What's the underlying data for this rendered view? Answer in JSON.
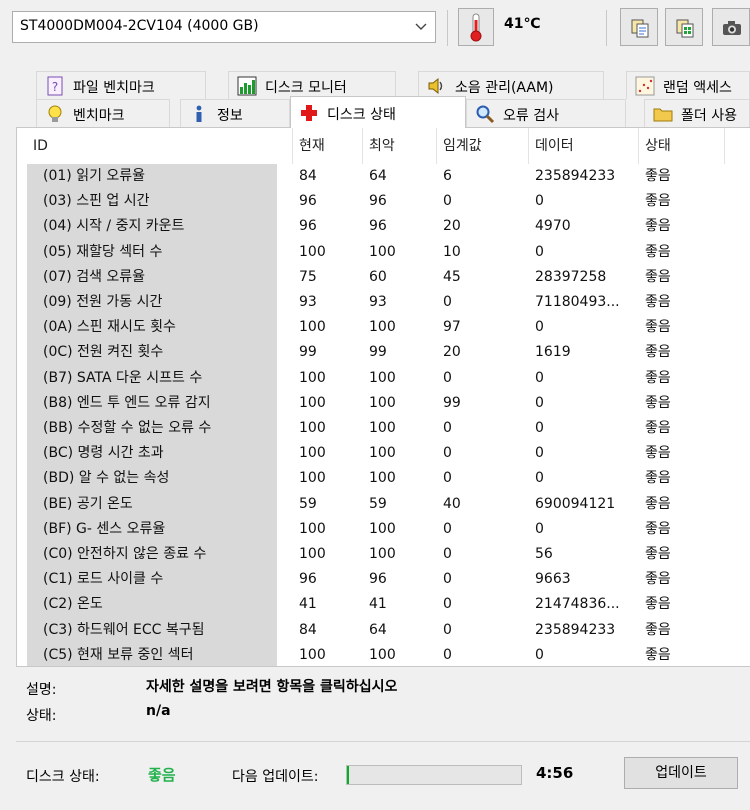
{
  "toolbar": {
    "drive": "ST4000DM004-2CV104 (4000 GB)",
    "temperature": "41℃"
  },
  "tabs": {
    "row1": [
      "파일 벤치마크",
      "디스크 모니터",
      "소음 관리(AAM)",
      "랜덤 액세스"
    ],
    "row2": [
      "벤치마크",
      "정보",
      "디스크 상태",
      "오류 검사",
      "폴더 사용"
    ],
    "active": "디스크 상태"
  },
  "table": {
    "headers": [
      "ID",
      "현재",
      "최악",
      "임계값",
      "데이터",
      "상태"
    ],
    "rows": [
      [
        "(01) 읽기 오류율",
        "84",
        "64",
        "6",
        "235894233",
        "좋음"
      ],
      [
        "(03) 스핀 업 시간",
        "96",
        "96",
        "0",
        "0",
        "좋음"
      ],
      [
        "(04) 시작 / 중지 카운트",
        "96",
        "96",
        "20",
        "4970",
        "좋음"
      ],
      [
        "(05) 재할당 섹터 수",
        "100",
        "100",
        "10",
        "0",
        "좋음"
      ],
      [
        "(07) 검색 오류율",
        "75",
        "60",
        "45",
        "28397258",
        "좋음"
      ],
      [
        "(09) 전원 가동 시간",
        "93",
        "93",
        "0",
        "71180493...",
        "좋음"
      ],
      [
        "(0A) 스핀 재시도 횟수",
        "100",
        "100",
        "97",
        "0",
        "좋음"
      ],
      [
        "(0C) 전원 켜진 횟수",
        "99",
        "99",
        "20",
        "1619",
        "좋음"
      ],
      [
        "(B7) SATA 다운 시프트 수",
        "100",
        "100",
        "0",
        "0",
        "좋음"
      ],
      [
        "(B8) 엔드 투 엔드 오류 감지",
        "100",
        "100",
        "99",
        "0",
        "좋음"
      ],
      [
        "(BB) 수정할 수 없는 오류 수",
        "100",
        "100",
        "0",
        "0",
        "좋음"
      ],
      [
        "(BC) 명령 시간 초과",
        "100",
        "100",
        "0",
        "0",
        "좋음"
      ],
      [
        "(BD) 알 수 없는 속성",
        "100",
        "100",
        "0",
        "0",
        "좋음"
      ],
      [
        "(BE) 공기 온도",
        "59",
        "59",
        "40",
        "690094121",
        "좋음"
      ],
      [
        "(BF) G- 센스 오류율",
        "100",
        "100",
        "0",
        "0",
        "좋음"
      ],
      [
        "(C0) 안전하지 않은 종료 수",
        "100",
        "100",
        "0",
        "56",
        "좋음"
      ],
      [
        "(C1) 로드 사이클 수",
        "96",
        "96",
        "0",
        "9663",
        "좋음"
      ],
      [
        "(C2) 온도",
        "41",
        "41",
        "0",
        "21474836...",
        "좋음"
      ],
      [
        "(C3) 하드웨어 ECC 복구됨",
        "84",
        "64",
        "0",
        "235894233",
        "좋음"
      ],
      [
        "(C5) 현재 보류 중인 섹터",
        "100",
        "100",
        "0",
        "0",
        "좋음"
      ]
    ]
  },
  "details": {
    "description_label": "설명:",
    "description_value": "자세한 설명을 보려면 항목을 클릭하십시오",
    "status_label": "상태:",
    "status_value": "n/a"
  },
  "footer": {
    "disk_status_label": "디스크 상태:",
    "disk_status_value": "좋음",
    "next_update_label": "다음 업데이트:",
    "progress_fraction": 0.01,
    "timer": "4:56",
    "update_button": "업데이트"
  },
  "colors": {
    "good": "#22b14c",
    "progress": "#06b025"
  },
  "icons": {
    "toolbar": [
      "thermometer-icon",
      "copy-icon",
      "copy-all-icon",
      "camera-icon"
    ],
    "tabs_row1": [
      "file-benchmark-icon",
      "disk-monitor-icon",
      "speaker-icon",
      "random-access-icon"
    ],
    "tabs_row2": [
      "lightbulb-icon",
      "info-icon",
      "red-cross-icon",
      "magnifier-icon",
      "folder-icon"
    ]
  }
}
